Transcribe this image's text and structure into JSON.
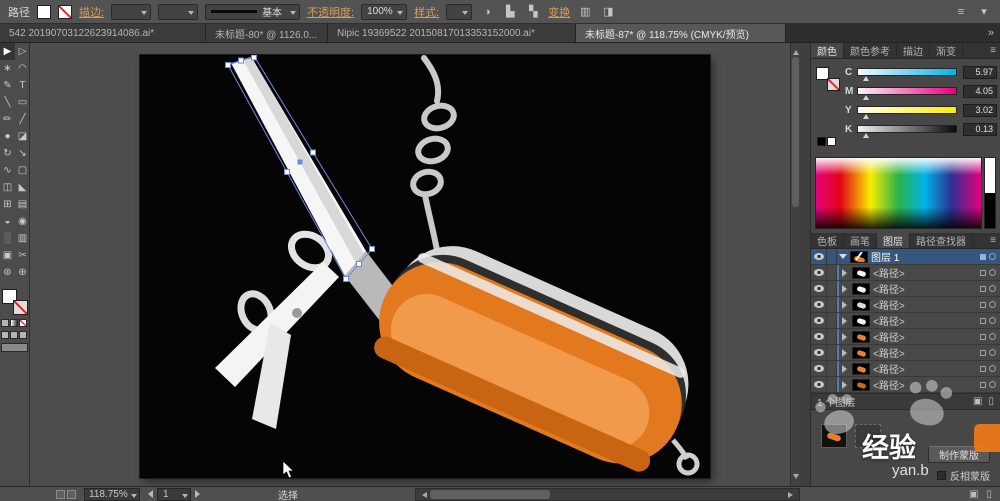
{
  "control_bar": {
    "context_label": "路径",
    "stroke_link": "描边:",
    "brush_value": "基本",
    "opacity_link": "不透明度:",
    "opacity_value": "100%",
    "style_link": "样式:",
    "transform_link": "变换",
    "icons": [
      {
        "name": "recolor-artwork-icon",
        "glyph": "◑"
      },
      {
        "name": "align-objects-icon",
        "glyph": "▙"
      },
      {
        "name": "distribute-objects-icon",
        "glyph": "▚"
      },
      {
        "name": "transform-panel-icon",
        "glyph": "▥"
      },
      {
        "name": "shape-mode-icon",
        "glyph": "◨"
      },
      {
        "name": "control-menu-icon",
        "glyph": "≡"
      },
      {
        "name": "collapse-icon",
        "glyph": "▾"
      }
    ]
  },
  "tabs": [
    {
      "label": "542 20190703122623914086.ai*"
    },
    {
      "label": "未标题-80* @ 1126.0..."
    },
    {
      "label": "Nipic 19369522 20150817013353152000.ai*"
    },
    {
      "label": "未标题-87* @ 118.75% (CMYK/预览)"
    }
  ],
  "icons": {
    "tab_overflow": "»",
    "panel_menu": "≡",
    "new_item": "▣",
    "delete_item": "▯"
  },
  "toolbar": {
    "tools": [
      {
        "name": "selection-tool",
        "glyph": "▶"
      },
      {
        "name": "direct-selection-tool",
        "glyph": "▷"
      },
      {
        "name": "magic-wand-tool",
        "glyph": "∗"
      },
      {
        "name": "lasso-tool",
        "glyph": "◠"
      },
      {
        "name": "pen-tool",
        "glyph": "✎"
      },
      {
        "name": "type-tool",
        "glyph": "T"
      },
      {
        "name": "line-segment-tool",
        "glyph": "╲"
      },
      {
        "name": "rectangle-tool",
        "glyph": "▭"
      },
      {
        "name": "paintbrush-tool",
        "glyph": "✏"
      },
      {
        "name": "pencil-tool",
        "glyph": "╱"
      },
      {
        "name": "blob-brush-tool",
        "glyph": "●"
      },
      {
        "name": "eraser-tool",
        "glyph": "◪"
      },
      {
        "name": "rotate-tool",
        "glyph": "↻"
      },
      {
        "name": "scale-tool",
        "glyph": "↘"
      },
      {
        "name": "width-tool",
        "glyph": "∿"
      },
      {
        "name": "free-transform-tool",
        "glyph": "▢"
      },
      {
        "name": "shape-builder-tool",
        "glyph": "◫"
      },
      {
        "name": "perspective-grid-tool",
        "glyph": "◣"
      },
      {
        "name": "mesh-tool",
        "glyph": "⊞"
      },
      {
        "name": "gradient-tool",
        "glyph": "▤"
      },
      {
        "name": "eyedropper-tool",
        "glyph": "◒"
      },
      {
        "name": "blend-tool",
        "glyph": "◉"
      },
      {
        "name": "symbol-sprayer-tool",
        "glyph": "░"
      },
      {
        "name": "column-graph-tool",
        "glyph": "▥"
      },
      {
        "name": "artboard-tool",
        "glyph": "▣"
      },
      {
        "name": "slice-tool",
        "glyph": "✂"
      },
      {
        "name": "hand-tool",
        "glyph": "⊛"
      },
      {
        "name": "zoom-tool",
        "glyph": "⊕"
      }
    ]
  },
  "dock": {
    "color_panel": {
      "tabs": [
        "颜色",
        "颜色参考",
        "描边",
        "渐变"
      ],
      "channels": [
        {
          "label": "C",
          "value": "5.97"
        },
        {
          "label": "M",
          "value": "4.05"
        },
        {
          "label": "Y",
          "value": "3.02"
        },
        {
          "label": "K",
          "value": "0.13"
        }
      ]
    },
    "panel_tabs": [
      "色板",
      "画笔",
      "图层",
      "路径查找器"
    ],
    "layers": {
      "header": "图层 1",
      "rows": [
        {
          "label": "<路径>",
          "thumb": "#f4f4f4"
        },
        {
          "label": "<路径>",
          "thumb": "#f4f4f4"
        },
        {
          "label": "<路径>",
          "thumb": "#dcdcdc"
        },
        {
          "label": "<路径>",
          "thumb": "#f4f4f4"
        },
        {
          "label": "<路径>",
          "thumb": "#e8812f"
        },
        {
          "label": "<路径>",
          "thumb": "#e8812f"
        },
        {
          "label": "<路径>",
          "thumb": "#e8812f"
        },
        {
          "label": "<路径>",
          "thumb": "#c96a1a"
        }
      ],
      "footer": "1 个图层"
    },
    "transparency": {
      "make_mask": "制作蒙版",
      "invert_mask": "反相蒙版"
    }
  },
  "status_bar": {
    "zoom": "118.75%",
    "artboard": "1",
    "tool": "选择"
  },
  "watermark": {
    "brand": "经验",
    "partial": "yan.b"
  },
  "artwork": {
    "colors": {
      "body_orange": "#e2791f",
      "body_highlight": "#f19a4b",
      "body_shadow": "#c96412",
      "metal": "#d8d8d8",
      "selection_blue": "#6a8bdf",
      "artboard_bg": "#050505"
    }
  }
}
